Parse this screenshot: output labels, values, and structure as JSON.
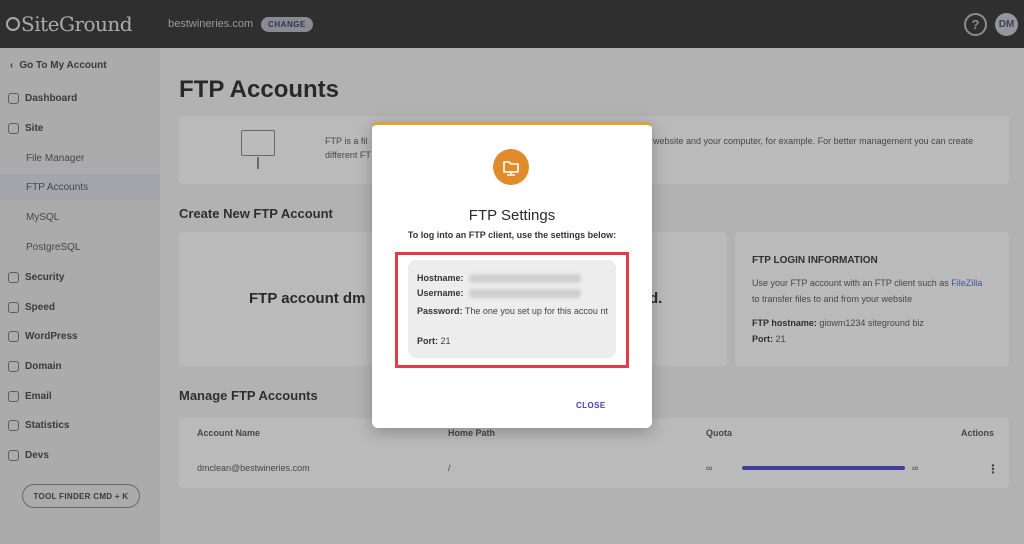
{
  "topbar": {
    "logo": "SiteGround",
    "domain": "bestwineries.com",
    "change_label": "CHANGE",
    "help_icon": "?",
    "avatar_initials": "DM"
  },
  "sidebar": {
    "back": "Go To My Account",
    "items": [
      {
        "label": "Dashboard",
        "icon": "dashboard-icon"
      },
      {
        "label": "Site",
        "icon": "site-icon"
      },
      {
        "label": "Security",
        "icon": "security-icon"
      },
      {
        "label": "Speed",
        "icon": "speed-icon"
      },
      {
        "label": "WordPress",
        "icon": "wordpress-icon"
      },
      {
        "label": "Domain",
        "icon": "domain-icon"
      },
      {
        "label": "Email",
        "icon": "email-icon"
      },
      {
        "label": "Statistics",
        "icon": "statistics-icon"
      },
      {
        "label": "Devs",
        "icon": "devs-icon"
      }
    ],
    "sub_items": [
      "File Manager",
      "FTP Accounts",
      "MySQL",
      "PostgreSQL"
    ],
    "tool_finder": "TOOL FINDER CMD + K"
  },
  "main": {
    "title": "FTP Accounts",
    "info_left": "FTP is a fil different FT",
    "info_right": "website and your computer, for example. For better management you can create",
    "create_heading": "Create New FTP Account",
    "create_text_left": "FTP account dm",
    "create_text_right": "d.",
    "login_info": {
      "title": "FTP LOGIN INFORMATION",
      "text_before": "Use your FTP account with an FTP client such as",
      "link": "FileZilla",
      "text_after": "to transfer files to and from your website",
      "hostname_label": "FTP hostname:",
      "hostname_value": "giowm1234 siteground biz",
      "port_label": "Port:",
      "port_value": "21"
    },
    "manage_heading": "Manage FTP Accounts",
    "table": {
      "headers": [
        "Account Name",
        "Home Path",
        "Quota",
        "Actions"
      ],
      "row": {
        "account": "dmclean@bestwineries.com",
        "path": "/",
        "quota_left": "∞",
        "quota_right": "∞"
      }
    }
  },
  "modal": {
    "icon": "ftp-folder-icon",
    "title": "FTP Settings",
    "subtitle": "To log into an FTP client, use the settings below:",
    "hostname_label": "Hostname:",
    "username_label": "Username:",
    "password_label": "Password:",
    "password_value": "The one you set up for this accou nt",
    "port_label": "Port:",
    "port_value": "21",
    "close_label": "CLOSE"
  },
  "colors": {
    "accent": "#e08c2c",
    "highlight": "#e23b4a",
    "link": "#3f3fb5"
  }
}
